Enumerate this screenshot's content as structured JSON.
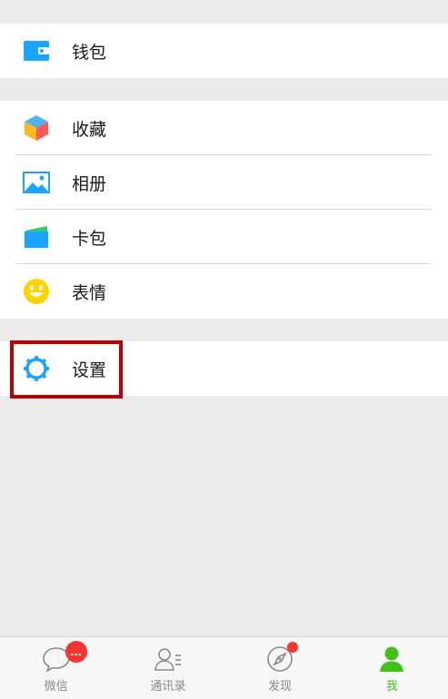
{
  "menu": {
    "wallet": {
      "label": "钱包",
      "icon": "wallet-icon"
    },
    "favorites": {
      "label": "收藏",
      "icon": "favorites-cube-icon"
    },
    "album": {
      "label": "相册",
      "icon": "photo-album-icon"
    },
    "cards": {
      "label": "卡包",
      "icon": "card-wallet-icon"
    },
    "stickers": {
      "label": "表情",
      "icon": "smiley-icon"
    },
    "settings": {
      "label": "设置",
      "icon": "gear-icon"
    }
  },
  "tabbar": {
    "chats": {
      "label": "微信",
      "badge": "...",
      "icon": "chat-bubble-icon"
    },
    "contacts": {
      "label": "通讯录",
      "icon": "contacts-icon"
    },
    "discover": {
      "label": "发现",
      "icon": "compass-icon",
      "dot": true
    },
    "me": {
      "label": "我",
      "icon": "person-icon",
      "active": true
    }
  },
  "colors": {
    "accent": "#45c01a",
    "badge": "#f43530",
    "highlight": "#c00000",
    "icon_blue": "#1aa3ff"
  }
}
